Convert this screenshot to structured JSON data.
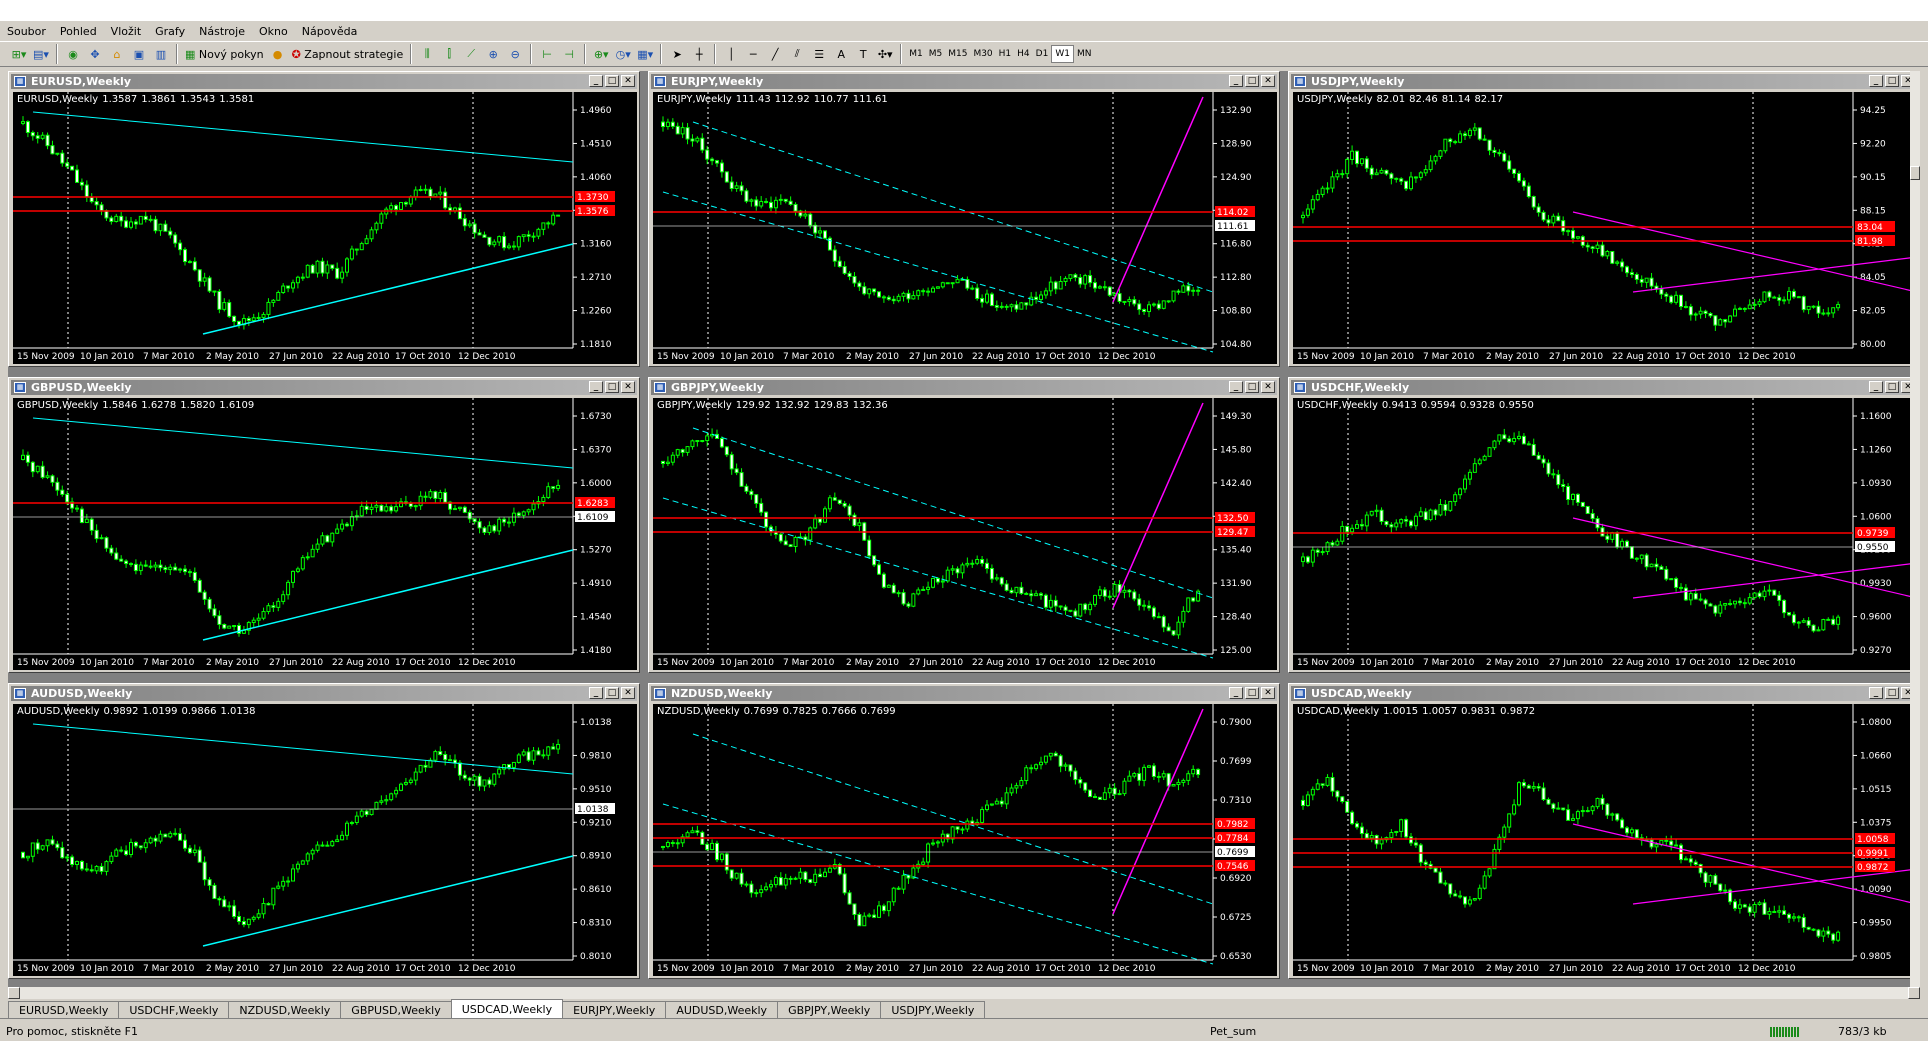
{
  "menu": {
    "items": [
      "Soubor",
      "Pohled",
      "Vložit",
      "Grafy",
      "Nástroje",
      "Okno",
      "Nápověda"
    ]
  },
  "toolbar": {
    "new_order_label": "Nový pokyn",
    "strategies_label": "Zapnout strategie",
    "timeframes": [
      "M1",
      "M5",
      "M15",
      "M30",
      "H1",
      "H4",
      "D1",
      "W1",
      "MN"
    ],
    "active_timeframe": "W1",
    "text_tool": "A"
  },
  "charts": [
    {
      "title": "EURUSD,Weekly",
      "symbol_line": "EURUSD,Weekly",
      "ohlc": [
        "1.3587",
        "1.3861",
        "1.3543",
        "1.3581"
      ],
      "price_labels": [
        "1.4960",
        "1.4510",
        "1.4060",
        "1.3610",
        "1.3160",
        "1.2710",
        "1.2260",
        "1.1810"
      ],
      "tag_labels": [
        {
          "text": "1.3730",
          "color": "red"
        },
        {
          "text": "1.3576",
          "color": "red"
        }
      ],
      "dates": [
        "15 Nov 2009",
        "10 Jan 2010",
        "7 Mar 2010",
        "2 May 2010",
        "27 Jun 2010",
        "22 Aug 2010",
        "17 Oct 2010",
        "12 Dec 2010"
      ],
      "pmin": 1.181,
      "pmax": 1.52,
      "seed": 11,
      "path": [
        1.49,
        1.46,
        1.42,
        1.37,
        1.35,
        1.36,
        1.33,
        1.29,
        1.24,
        1.21,
        1.23,
        1.27,
        1.29,
        1.28,
        1.33,
        1.37,
        1.39,
        1.39,
        1.36,
        1.33,
        1.32,
        1.34,
        1.36
      ]
    },
    {
      "title": "EURJPY,Weekly",
      "symbol_line": "EURJPY,Weekly",
      "ohlc": [
        "111.43",
        "112.92",
        "110.77",
        "111.61"
      ],
      "price_labels": [
        "132.90",
        "128.90",
        "124.90",
        "120.90",
        "116.80",
        "112.80",
        "108.80",
        "104.80"
      ],
      "tag_labels": [
        {
          "text": "114.02",
          "color": "red"
        },
        {
          "text": "111.61",
          "color": "white"
        }
      ],
      "dates": [
        "15 Nov 2009",
        "10 Jan 2010",
        "7 Mar 2010",
        "2 May 2010",
        "27 Jun 2010",
        "22 Aug 2010",
        "17 Oct 2010",
        "12 Dec 2010"
      ],
      "pmin": 104.8,
      "pmax": 135.0,
      "seed": 23,
      "path": [
        132.5,
        131,
        128,
        124,
        122,
        123,
        120,
        116,
        112,
        110,
        111,
        112,
        113,
        111,
        109,
        110,
        112,
        113,
        112,
        110,
        109,
        111,
        112
      ]
    },
    {
      "title": "USDJPY,Weekly",
      "symbol_line": "USDJPY,Weekly",
      "ohlc": [
        "82.01",
        "82.46",
        "81.14",
        "82.17"
      ],
      "price_labels": [
        "94.25",
        "92.20",
        "90.15",
        "88.15",
        "86.10",
        "84.05",
        "82.05",
        "80.00"
      ],
      "tag_labels": [
        {
          "text": "83.04",
          "color": "red"
        },
        {
          "text": "81.98",
          "color": "red"
        }
      ],
      "dates": [
        "15 Nov 2009",
        "10 Jan 2010",
        "7 Mar 2010",
        "2 May 2010",
        "27 Jun 2010",
        "22 Aug 2010",
        "17 Oct 2010",
        "12 Dec 2010"
      ],
      "pmin": 79.8,
      "pmax": 95.5,
      "seed": 37,
      "path": [
        88,
        90,
        92,
        91,
        90,
        91,
        93,
        94,
        92,
        90,
        88,
        87,
        86,
        85,
        84,
        83,
        82,
        81,
        82,
        83,
        83,
        82,
        82
      ]
    },
    {
      "title": "GBPUSD,Weekly",
      "symbol_line": "GBPUSD,Weekly",
      "ohlc": [
        "1.5846",
        "1.6278",
        "1.5820",
        "1.6109"
      ],
      "price_labels": [
        "1.6730",
        "1.6370",
        "1.6000",
        "1.5640",
        "1.5270",
        "1.4910",
        "1.4540",
        "1.4180"
      ],
      "tag_labels": [
        {
          "text": "1.6283",
          "color": "red"
        },
        {
          "text": "1.6109",
          "color": "white"
        }
      ],
      "dates": [
        "15 Nov 2009",
        "10 Jan 2010",
        "7 Mar 2010",
        "2 May 2010",
        "27 Jun 2010",
        "22 Aug 2010",
        "17 Oct 2010",
        "12 Dec 2010"
      ],
      "pmin": 1.418,
      "pmax": 1.7,
      "seed": 41,
      "path": [
        1.64,
        1.62,
        1.59,
        1.55,
        1.52,
        1.51,
        1.52,
        1.5,
        1.45,
        1.44,
        1.46,
        1.5,
        1.54,
        1.56,
        1.58,
        1.58,
        1.59,
        1.6,
        1.58,
        1.56,
        1.57,
        1.59,
        1.61
      ]
    },
    {
      "title": "GBPJPY,Weekly",
      "symbol_line": "GBPJPY,Weekly",
      "ohlc": [
        "129.92",
        "132.92",
        "129.83",
        "132.36"
      ],
      "price_labels": [
        "149.30",
        "145.80",
        "142.40",
        "138.90",
        "135.40",
        "131.90",
        "128.40",
        "125.00"
      ],
      "tag_labels": [
        {
          "text": "132.50",
          "color": "red"
        },
        {
          "text": "129.47",
          "color": "red"
        }
      ],
      "dates": [
        "15 Nov 2009",
        "10 Jan 2010",
        "7 Mar 2010",
        "2 May 2010",
        "27 Jun 2010",
        "22 Aug 2010",
        "17 Oct 2010",
        "12 Dec 2010"
      ],
      "pmin": 124.8,
      "pmax": 152.0,
      "seed": 53,
      "path": [
        146,
        148,
        149,
        145,
        140,
        136,
        138,
        142,
        139,
        132,
        130,
        132,
        134,
        135,
        132,
        131,
        130,
        129,
        131,
        132,
        129,
        127,
        132
      ]
    },
    {
      "title": "USDCHF,Weekly",
      "symbol_line": "USDCHF,Weekly",
      "ohlc": [
        "0.9413",
        "0.9594",
        "0.9328",
        "0.9550"
      ],
      "price_labels": [
        "1.1600",
        "1.1260",
        "1.0930",
        "1.0600",
        "1.0260",
        "0.9930",
        "0.9600",
        "0.9270"
      ],
      "tag_labels": [
        {
          "text": "0.9739",
          "color": "red"
        },
        {
          "text": "0.9550",
          "color": "white"
        }
      ],
      "dates": [
        "15 Nov 2009",
        "10 Jan 2010",
        "7 Mar 2010",
        "2 May 2010",
        "27 Jun 2010",
        "22 Aug 2010",
        "17 Oct 2010",
        "12 Dec 2010"
      ],
      "pmin": 0.925,
      "pmax": 1.185,
      "seed": 67,
      "path": [
        1.02,
        1.04,
        1.06,
        1.07,
        1.06,
        1.07,
        1.08,
        1.12,
        1.16,
        1.15,
        1.12,
        1.09,
        1.06,
        1.04,
        1.02,
        1.0,
        0.98,
        0.97,
        0.98,
        0.99,
        0.96,
        0.95,
        0.955
      ]
    },
    {
      "title": "AUDUSD,Weekly",
      "symbol_line": "AUDUSD,Weekly",
      "ohlc": [
        "0.9892",
        "1.0199",
        "0.9866",
        "1.0138"
      ],
      "price_labels": [
        "1.0138",
        "0.9810",
        "0.9510",
        "0.9210",
        "0.8910",
        "0.8610",
        "0.8310",
        "0.8010"
      ],
      "tag_labels": [
        {
          "text": "1.0138",
          "color": "white"
        }
      ],
      "dates": [
        "15 Nov 2009",
        "10 Jan 2010",
        "7 Mar 2010",
        "2 May 2010",
        "27 Jun 2010",
        "22 Aug 2010",
        "17 Oct 2010",
        "12 Dec 2010"
      ],
      "pmin": 0.795,
      "pmax": 1.04,
      "seed": 71,
      "path": [
        0.9,
        0.91,
        0.89,
        0.88,
        0.9,
        0.91,
        0.92,
        0.9,
        0.85,
        0.83,
        0.85,
        0.88,
        0.9,
        0.92,
        0.94,
        0.96,
        0.98,
        1.0,
        0.98,
        0.97,
        0.99,
        1.0,
        1.01
      ]
    },
    {
      "title": "NZDUSD,Weekly",
      "symbol_line": "NZDUSD,Weekly",
      "ohlc": [
        "0.7699",
        "0.7825",
        "0.7666",
        "0.7699"
      ],
      "price_labels": [
        "0.7900",
        "0.7699",
        "0.7310",
        "0.7115",
        "0.6920",
        "0.6725",
        "0.6530"
      ],
      "tag_labels": [
        {
          "text": "0.7982",
          "color": "red"
        },
        {
          "text": "0.7784",
          "color": "red"
        },
        {
          "text": "0.7699",
          "color": "white"
        },
        {
          "text": "0.7546",
          "color": "red"
        }
      ],
      "dates": [
        "15 Nov 2009",
        "10 Jan 2010",
        "7 Mar 2010",
        "2 May 2010",
        "27 Jun 2010",
        "22 Aug 2010",
        "17 Oct 2010",
        "12 Dec 2010"
      ],
      "pmin": 0.65,
      "pmax": 0.805,
      "seed": 83,
      "path": [
        0.72,
        0.73,
        0.72,
        0.7,
        0.69,
        0.7,
        0.7,
        0.71,
        0.67,
        0.68,
        0.7,
        0.72,
        0.73,
        0.74,
        0.75,
        0.77,
        0.78,
        0.76,
        0.75,
        0.76,
        0.77,
        0.76,
        0.77
      ]
    },
    {
      "title": "USDCAD,Weekly",
      "symbol_line": "USDCAD,Weekly",
      "ohlc": [
        "1.0015",
        "1.0057",
        "0.9831",
        "0.9872"
      ],
      "price_labels": [
        "1.0800",
        "1.0660",
        "1.0515",
        "1.0375",
        "1.0230",
        "1.0090",
        "0.9950",
        "0.9805"
      ],
      "tag_labels": [
        {
          "text": "1.0058",
          "color": "red"
        },
        {
          "text": "0.9991",
          "color": "red"
        },
        {
          "text": "0.9872",
          "color": "red"
        }
      ],
      "dates": [
        "15 Nov 2009",
        "10 Jan 2010",
        "7 Mar 2010",
        "2 May 2010",
        "27 Jun 2010",
        "22 Aug 2010",
        "17 Oct 2010",
        "12 Dec 2010"
      ],
      "pmin": 0.978,
      "pmax": 1.09,
      "seed": 97,
      "path": [
        1.05,
        1.06,
        1.04,
        1.03,
        1.04,
        1.02,
        1.01,
        1.0,
        1.03,
        1.06,
        1.05,
        1.04,
        1.05,
        1.04,
        1.03,
        1.03,
        1.02,
        1.01,
        1.0,
        1.0,
        0.995,
        0.99,
        0.987
      ]
    }
  ],
  "tabs": {
    "items": [
      "EURUSD,Weekly",
      "USDCHF,Weekly",
      "NZDUSD,Weekly",
      "GBPUSD,Weekly",
      "USDCAD,Weekly",
      "EURJPY,Weekly",
      "AUDUSD,Weekly",
      "GBPJPY,Weekly",
      "USDJPY,Weekly"
    ],
    "active": "USDCAD,Weekly"
  },
  "status": {
    "help": "Pro pomoc, stiskněte F1",
    "profile": "Pet_sum",
    "traffic": "783/3 kb"
  },
  "colors": {
    "bull": "#00ff00",
    "bear": "#00ff00",
    "level": "#ff0000",
    "cyan": "#00ffff",
    "magenta": "#ff00ff"
  }
}
